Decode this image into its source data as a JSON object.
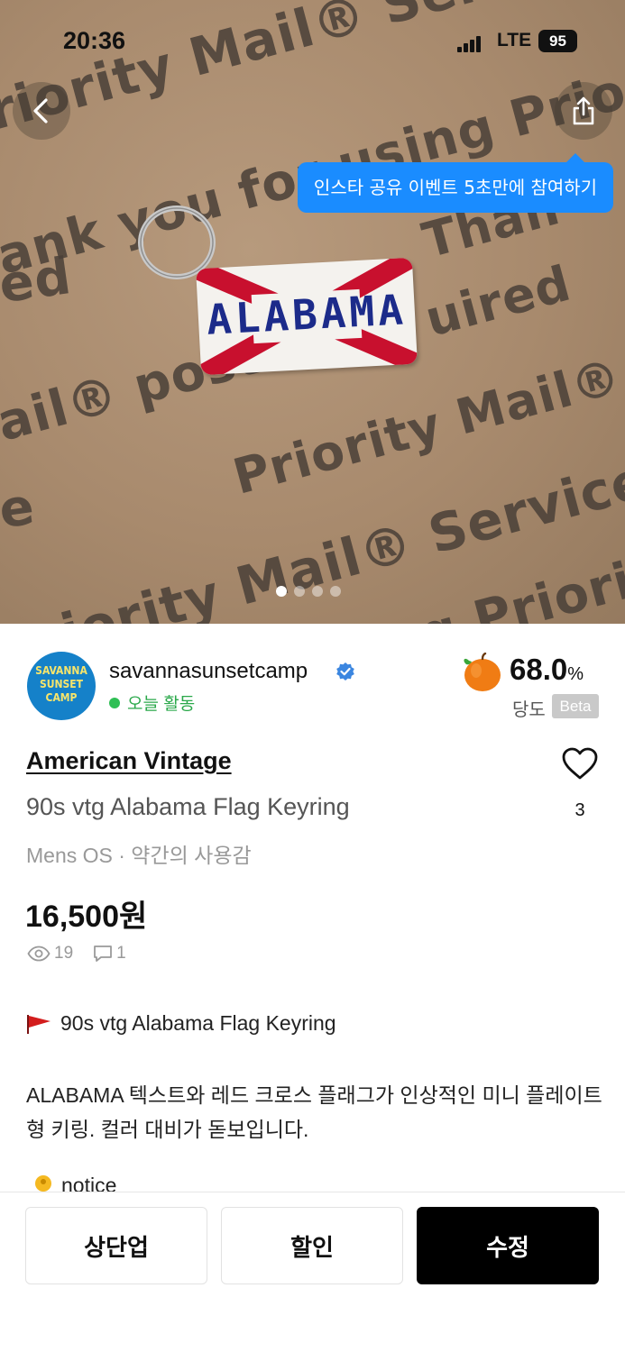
{
  "status_bar": {
    "time": "20:36",
    "network": "LTE",
    "battery": "95"
  },
  "hero": {
    "tooltip": "인스타 공유 이벤트 5초만에 참여하기",
    "photo_texts": {
      "line1": "riority Mail® Service",
      "line2": "ank you for using Priorit",
      "line3": "ed",
      "line4": "ail® post",
      "line5": "Priority Mail® p",
      "line6": "e",
      "line7": "Priority Mail® Service",
      "line8": "ing Priorit",
      "line9": "uired",
      "line10": "Than"
    },
    "keyring_text": "ALABAMA",
    "page_count": 4,
    "current_page": 1
  },
  "seller": {
    "avatar_text": [
      "SAVANNA",
      "SUNSET",
      "CAMP"
    ],
    "name": "savannasunsetcamp",
    "activity": "오늘 활동",
    "sweetness_value": "68.0",
    "sweetness_unit": "%",
    "sweetness_label": "당도",
    "beta_badge": "Beta"
  },
  "product": {
    "brand": "American Vintage",
    "title": "90s vtg Alabama Flag Keyring",
    "meta": "Mens OS · 약간의 사용감",
    "price": "16,500원",
    "views": "19",
    "comments": "1",
    "likes": "3"
  },
  "description": {
    "headline": "90s vtg Alabama Flag Keyring",
    "body": "ALABAMA 텍스트와 레드 크로스 플래그가 인상적인 미니 플레이트형 키링. 컬러 대비가 돋보입니다.",
    "notice": "notice"
  },
  "actions": {
    "bump": "상단업",
    "discount": "할인",
    "edit": "수정"
  },
  "colors": {
    "tooltip": "#1a8cff",
    "online": "#2fbf55",
    "verified": "#3b86e0",
    "primary_button": "#000000"
  }
}
